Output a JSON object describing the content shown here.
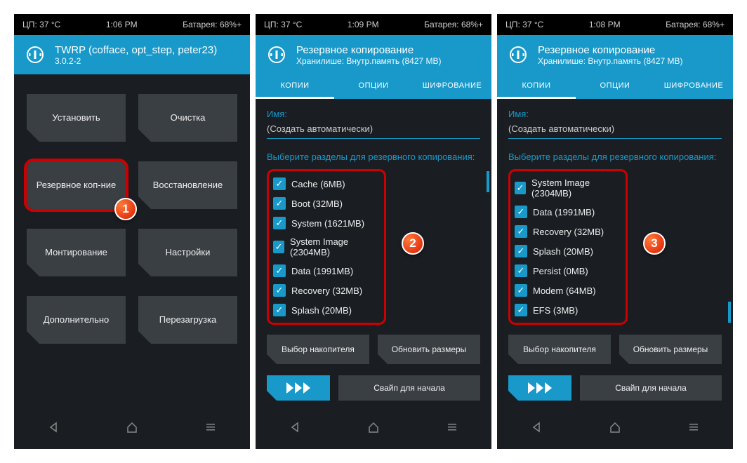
{
  "screens": [
    {
      "status": {
        "cpu": "ЦП: 37 °C",
        "time": "1:06 PM",
        "battery": "Батарея: 68%+"
      },
      "title": "TWRP (cofface, opt_step, peter23)",
      "subtitle": "3.0.2-2",
      "buttons": [
        "Установить",
        "Очистка",
        "Резервное коп-ние",
        "Восстановление",
        "Монтирование",
        "Настройки",
        "Дополнительно",
        "Перезагрузка"
      ],
      "highlight_index": 2,
      "badge": "1"
    },
    {
      "status": {
        "cpu": "ЦП: 37 °C",
        "time": "1:09 PM",
        "battery": "Батарея: 68%+"
      },
      "title": "Резервное копирование",
      "subtitle": "Хранилише: Внутр.память (8427 MB)",
      "tabs": [
        "КОПИИ",
        "ОПЦИИ",
        "ШИФРОВАНИЕ"
      ],
      "name_label": "Имя:",
      "name_value": "(Создать автоматически)",
      "section_label": "Выберите разделы для резервного копирования:",
      "partitions": [
        "Cache (6MB)",
        "Boot (32MB)",
        "System (1621MB)",
        "System Image (2304MB)",
        "Data (1991MB)",
        "Recovery (32MB)",
        "Splash (20MB)"
      ],
      "badge": "2",
      "btns": [
        "Выбор накопителя",
        "Обновить размеры"
      ],
      "swipe": "Свайп для начала"
    },
    {
      "status": {
        "cpu": "ЦП: 37 °C",
        "time": "1:08 PM",
        "battery": "Батарея: 68%+"
      },
      "title": "Резервное копирование",
      "subtitle": "Хранилише: Внутр.память (8427 MB)",
      "tabs": [
        "КОПИИ",
        "ОПЦИИ",
        "ШИФРОВАНИЕ"
      ],
      "name_label": "Имя:",
      "name_value": "(Создать автоматически)",
      "section_label": "Выберите разделы для резервного копирования:",
      "partitions": [
        "System Image (2304MB)",
        "Data (1991MB)",
        "Recovery (32MB)",
        "Splash (20MB)",
        "Persist (0MB)",
        "Modem (64MB)",
        "EFS (3MB)"
      ],
      "badge": "3",
      "btns": [
        "Выбор накопителя",
        "Обновить размеры"
      ],
      "swipe": "Свайп для начала"
    }
  ]
}
